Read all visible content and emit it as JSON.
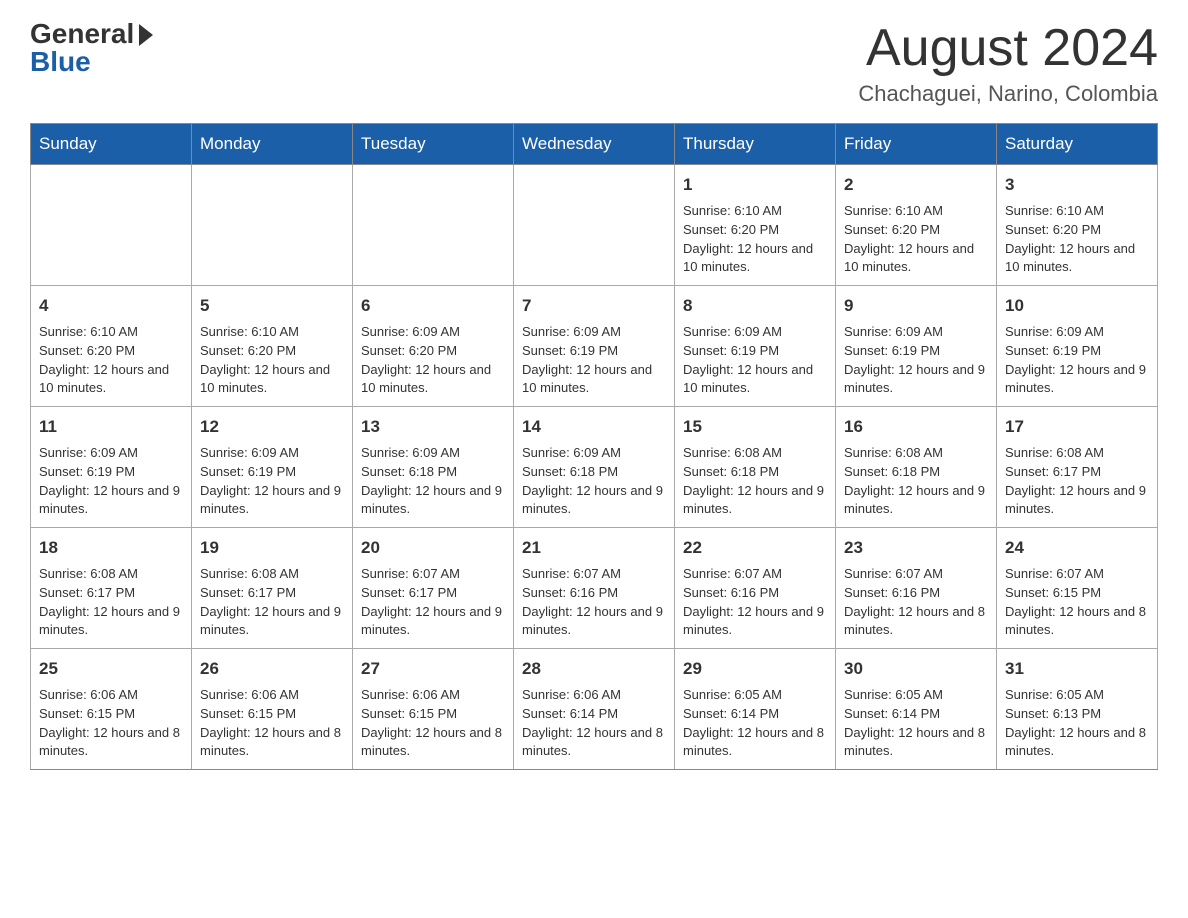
{
  "header": {
    "logo_general": "General",
    "logo_blue": "Blue",
    "month_title": "August 2024",
    "location": "Chachaguei, Narino, Colombia"
  },
  "days_of_week": [
    "Sunday",
    "Monday",
    "Tuesday",
    "Wednesday",
    "Thursday",
    "Friday",
    "Saturday"
  ],
  "weeks": [
    [
      {
        "day": "",
        "info": ""
      },
      {
        "day": "",
        "info": ""
      },
      {
        "day": "",
        "info": ""
      },
      {
        "day": "",
        "info": ""
      },
      {
        "day": "1",
        "info": "Sunrise: 6:10 AM\nSunset: 6:20 PM\nDaylight: 12 hours and 10 minutes."
      },
      {
        "day": "2",
        "info": "Sunrise: 6:10 AM\nSunset: 6:20 PM\nDaylight: 12 hours and 10 minutes."
      },
      {
        "day": "3",
        "info": "Sunrise: 6:10 AM\nSunset: 6:20 PM\nDaylight: 12 hours and 10 minutes."
      }
    ],
    [
      {
        "day": "4",
        "info": "Sunrise: 6:10 AM\nSunset: 6:20 PM\nDaylight: 12 hours and 10 minutes."
      },
      {
        "day": "5",
        "info": "Sunrise: 6:10 AM\nSunset: 6:20 PM\nDaylight: 12 hours and 10 minutes."
      },
      {
        "day": "6",
        "info": "Sunrise: 6:09 AM\nSunset: 6:20 PM\nDaylight: 12 hours and 10 minutes."
      },
      {
        "day": "7",
        "info": "Sunrise: 6:09 AM\nSunset: 6:19 PM\nDaylight: 12 hours and 10 minutes."
      },
      {
        "day": "8",
        "info": "Sunrise: 6:09 AM\nSunset: 6:19 PM\nDaylight: 12 hours and 10 minutes."
      },
      {
        "day": "9",
        "info": "Sunrise: 6:09 AM\nSunset: 6:19 PM\nDaylight: 12 hours and 9 minutes."
      },
      {
        "day": "10",
        "info": "Sunrise: 6:09 AM\nSunset: 6:19 PM\nDaylight: 12 hours and 9 minutes."
      }
    ],
    [
      {
        "day": "11",
        "info": "Sunrise: 6:09 AM\nSunset: 6:19 PM\nDaylight: 12 hours and 9 minutes."
      },
      {
        "day": "12",
        "info": "Sunrise: 6:09 AM\nSunset: 6:19 PM\nDaylight: 12 hours and 9 minutes."
      },
      {
        "day": "13",
        "info": "Sunrise: 6:09 AM\nSunset: 6:18 PM\nDaylight: 12 hours and 9 minutes."
      },
      {
        "day": "14",
        "info": "Sunrise: 6:09 AM\nSunset: 6:18 PM\nDaylight: 12 hours and 9 minutes."
      },
      {
        "day": "15",
        "info": "Sunrise: 6:08 AM\nSunset: 6:18 PM\nDaylight: 12 hours and 9 minutes."
      },
      {
        "day": "16",
        "info": "Sunrise: 6:08 AM\nSunset: 6:18 PM\nDaylight: 12 hours and 9 minutes."
      },
      {
        "day": "17",
        "info": "Sunrise: 6:08 AM\nSunset: 6:17 PM\nDaylight: 12 hours and 9 minutes."
      }
    ],
    [
      {
        "day": "18",
        "info": "Sunrise: 6:08 AM\nSunset: 6:17 PM\nDaylight: 12 hours and 9 minutes."
      },
      {
        "day": "19",
        "info": "Sunrise: 6:08 AM\nSunset: 6:17 PM\nDaylight: 12 hours and 9 minutes."
      },
      {
        "day": "20",
        "info": "Sunrise: 6:07 AM\nSunset: 6:17 PM\nDaylight: 12 hours and 9 minutes."
      },
      {
        "day": "21",
        "info": "Sunrise: 6:07 AM\nSunset: 6:16 PM\nDaylight: 12 hours and 9 minutes."
      },
      {
        "day": "22",
        "info": "Sunrise: 6:07 AM\nSunset: 6:16 PM\nDaylight: 12 hours and 9 minutes."
      },
      {
        "day": "23",
        "info": "Sunrise: 6:07 AM\nSunset: 6:16 PM\nDaylight: 12 hours and 8 minutes."
      },
      {
        "day": "24",
        "info": "Sunrise: 6:07 AM\nSunset: 6:15 PM\nDaylight: 12 hours and 8 minutes."
      }
    ],
    [
      {
        "day": "25",
        "info": "Sunrise: 6:06 AM\nSunset: 6:15 PM\nDaylight: 12 hours and 8 minutes."
      },
      {
        "day": "26",
        "info": "Sunrise: 6:06 AM\nSunset: 6:15 PM\nDaylight: 12 hours and 8 minutes."
      },
      {
        "day": "27",
        "info": "Sunrise: 6:06 AM\nSunset: 6:15 PM\nDaylight: 12 hours and 8 minutes."
      },
      {
        "day": "28",
        "info": "Sunrise: 6:06 AM\nSunset: 6:14 PM\nDaylight: 12 hours and 8 minutes."
      },
      {
        "day": "29",
        "info": "Sunrise: 6:05 AM\nSunset: 6:14 PM\nDaylight: 12 hours and 8 minutes."
      },
      {
        "day": "30",
        "info": "Sunrise: 6:05 AM\nSunset: 6:14 PM\nDaylight: 12 hours and 8 minutes."
      },
      {
        "day": "31",
        "info": "Sunrise: 6:05 AM\nSunset: 6:13 PM\nDaylight: 12 hours and 8 minutes."
      }
    ]
  ]
}
